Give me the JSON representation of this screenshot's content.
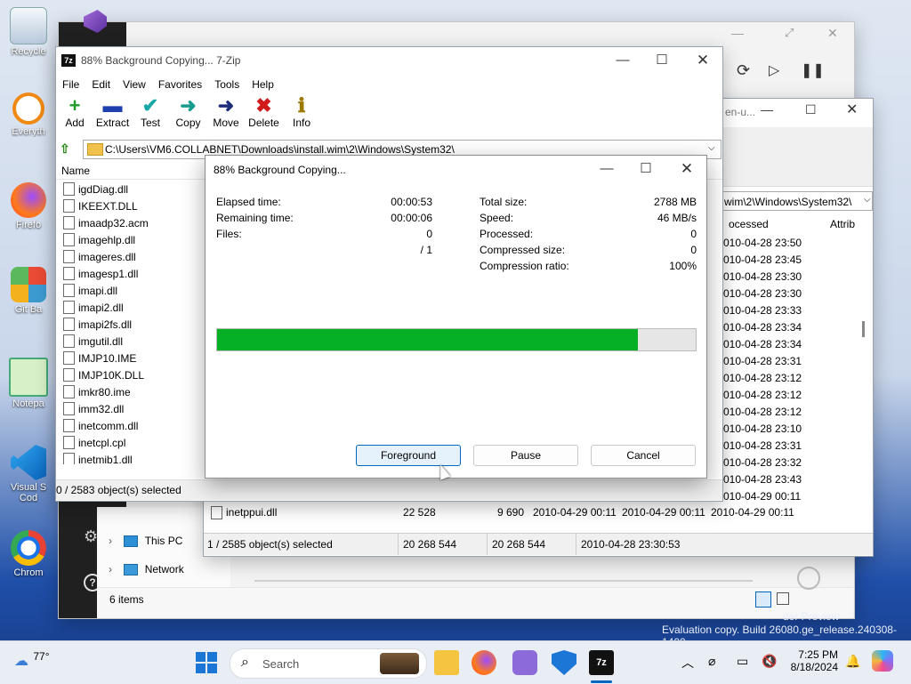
{
  "desktop": {
    "icons": [
      {
        "label": "Recycle",
        "icon": "recycle-bin-icon"
      },
      {
        "label": "Everyth",
        "icon": "everything-search-icon"
      },
      {
        "label": "Firefo",
        "icon": "firefox-icon"
      },
      {
        "label": "Git Ba",
        "icon": "git-bash-icon"
      },
      {
        "label": "Notepa",
        "icon": "notepad-icon"
      },
      {
        "label": "Visual S Cod",
        "icon": "vscode-icon"
      },
      {
        "label": "Chrom",
        "icon": "chrome-icon"
      }
    ],
    "watermark_line1": "der Preview",
    "watermark_line2": "Evaluation copy. Build 26080.ge_release.240308-1400"
  },
  "zip_window": {
    "title": "88% Background Copying... 7-Zip",
    "menu": [
      "File",
      "Edit",
      "View",
      "Favorites",
      "Tools",
      "Help"
    ],
    "toolbar": [
      {
        "label": "Add",
        "icon": "add-icon",
        "glyph": "+",
        "color": "#1f9d2a"
      },
      {
        "label": "Extract",
        "icon": "extract-icon",
        "glyph": "▬",
        "color": "#1e3fae"
      },
      {
        "label": "Test",
        "icon": "test-icon",
        "glyph": "✔",
        "color": "#18a7a7"
      },
      {
        "label": "Copy",
        "icon": "copy-icon",
        "glyph": "➜",
        "color": "#169b8f"
      },
      {
        "label": "Move",
        "icon": "move-icon",
        "glyph": "➜",
        "color": "#1c2d7a"
      },
      {
        "label": "Delete",
        "icon": "delete-icon",
        "glyph": "✖",
        "color": "#d11b1b"
      },
      {
        "label": "Info",
        "icon": "info-icon",
        "glyph": "ℹ",
        "color": "#9a7a00"
      }
    ],
    "path": "C:\\Users\\VM6.COLLABNET\\Downloads\\install.wim\\2\\Windows\\System32\\",
    "column_name": "Name",
    "files": [
      "igdDiag.dll",
      "IKEEXT.DLL",
      "imaadp32.acm",
      "imagehlp.dll",
      "imageres.dll",
      "imagesp1.dll",
      "imapi.dll",
      "imapi2.dll",
      "imapi2fs.dll",
      "imgutil.dll",
      "IMJP10.IME",
      "IMJP10K.DLL",
      "imkr80.ime",
      "imm32.dll",
      "inetcomm.dll",
      "inetcpl.cpl",
      "inetmib1.dll"
    ],
    "status": "0 / 2583 object(s) selected"
  },
  "back_window": {
    "path_tail": "wim\\2\\Windows\\System32\\",
    "col_processed": "ocessed",
    "col_attrib": "Attrib",
    "dates": [
      "010-04-28 23:50",
      "010-04-28 23:45",
      "010-04-28 23:30",
      "010-04-28 23:30",
      "010-04-28 23:33",
      "010-04-28 23:34",
      "010-04-28 23:34",
      "010-04-28 23:31",
      "010-04-28 23:12",
      "010-04-28 23:12",
      "010-04-28 23:12",
      "010-04-28 23:10",
      "010-04-28 23:31",
      "010-04-28 23:32",
      "010-04-28 23:43",
      "010-04-29 00:11"
    ],
    "bottom_row": {
      "name": "inetppui.dll",
      "size": "22 528",
      "packed": "9 690",
      "modified": "2010-04-29 00:11",
      "created": "2010-04-29 00:11",
      "accessed": "2010-04-29 00:11"
    },
    "status": {
      "selected": "1 / 2585 object(s) selected",
      "size1": "20 268 544",
      "size2": "20 268 544",
      "date": "2010-04-28 23:30:53"
    },
    "title_fragment": "en-u..."
  },
  "explorer": {
    "nav": [
      {
        "label": "This PC",
        "icon": "this-pc-icon"
      },
      {
        "label": "Network",
        "icon": "network-icon"
      }
    ],
    "items_count": "6 items"
  },
  "progress_dialog": {
    "title": "88% Background Copying...",
    "left_labels": [
      "Elapsed time:",
      "Remaining time:",
      "Files:"
    ],
    "left_values": [
      "00:00:53",
      "00:00:06",
      "0",
      "/ 1"
    ],
    "right_labels": [
      "Total size:",
      "Speed:",
      "Processed:",
      "Compressed size:",
      "Compression ratio:"
    ],
    "right_values": [
      "2788 MB",
      "46 MB/s",
      "0",
      "0",
      "100%"
    ],
    "progress": 0.88,
    "progress_color": "#06b025",
    "buttons": {
      "foreground": "Foreground",
      "pause": "Pause",
      "cancel": "Cancel"
    }
  },
  "taskbar": {
    "weather": "77°",
    "search": "Search",
    "time": "7:25 PM",
    "date": "8/18/2024"
  }
}
